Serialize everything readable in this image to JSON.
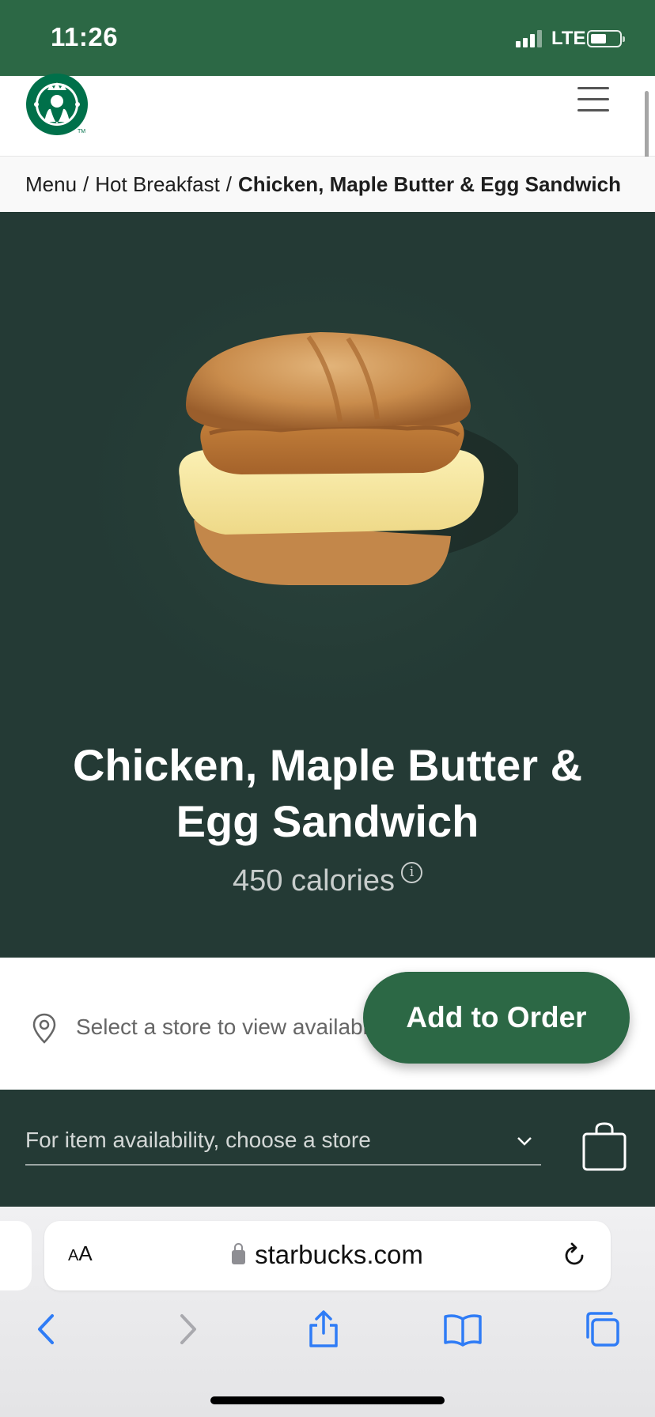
{
  "status_bar": {
    "time": "11:26",
    "network": "LTE",
    "battery_level": 0.55
  },
  "header": {
    "logo_icon": "starbucks-siren-logo",
    "menu_icon": "hamburger-menu-icon"
  },
  "breadcrumb": {
    "items": [
      "Menu",
      "Hot Breakfast"
    ],
    "separator": "/",
    "current": "Chicken, Maple Butter & Egg Sandwich"
  },
  "product": {
    "image_icon": "sandwich-image",
    "title_line1": "Chicken, Maple Butter &",
    "title_line2": "Egg Sandwich",
    "calories": "450 calories",
    "info_symbol": "i"
  },
  "store": {
    "select_text": "Select a store to view availability",
    "add_to_order": "Add to Order"
  },
  "availability": {
    "placeholder": "For item availability, choose a store",
    "bag_icon": "shopping-bag-icon"
  },
  "browser": {
    "text_size_small": "A",
    "text_size_large": "A",
    "url": "starbucks.com",
    "buttons": [
      "back-icon",
      "forward-icon",
      "share-icon",
      "bookmarks-icon",
      "tabs-icon"
    ]
  },
  "colors": {
    "brand_green": "#2c6845",
    "house_green": "#243a35",
    "ios_blue": "#2f7cf6"
  }
}
